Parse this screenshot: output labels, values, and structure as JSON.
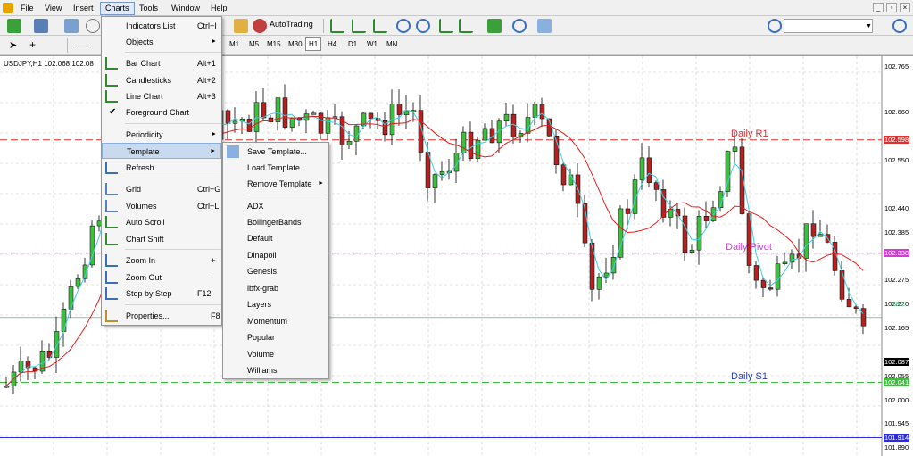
{
  "menubar": {
    "items": [
      "File",
      "View",
      "Insert",
      "Charts",
      "Tools",
      "Window",
      "Help"
    ],
    "window_controls": [
      "_",
      "▫",
      "×"
    ]
  },
  "toolbar": {
    "autotrading_label": "AutoTrading",
    "timeframes": [
      "M1",
      "M5",
      "M15",
      "M30",
      "H1",
      "H4",
      "D1",
      "W1",
      "MN"
    ],
    "active_timeframe": "H1",
    "search_value": ""
  },
  "chart": {
    "title": "USDJPY,H1  102.068 102.08",
    "price_axis": [
      "102.765",
      "102.660",
      "102.598",
      "102.550",
      "102.440",
      "102.385",
      "102.338",
      "102.275",
      "102.220",
      "102.165",
      "102.087",
      "102.055",
      "102.041",
      "102.000",
      "101.945",
      "101.914",
      "101.890"
    ],
    "highlighted_prices": {
      "r1": "102.598",
      "pivot": "102.338",
      "bid": "102.087",
      "s1": "102.041",
      "low": "101.914"
    },
    "levels": {
      "r1_label": "Daily R1",
      "pivot_label": "Daily Pivot",
      "s1_label": "Daily S1"
    },
    "fib_label": "38.2",
    "colors": {
      "r1": "#e03030",
      "pivot": "#d040d0",
      "s1": "#3cbf3c",
      "low": "#2a2ae0",
      "fib": "#3aa36a",
      "bull": "#3cbf3c",
      "bear": "#b22222",
      "ma_red": "#e02020",
      "ma_cyan": "#40d0e0"
    }
  },
  "charts_menu": {
    "items": [
      {
        "label": "Indicators List",
        "shortcut": "Ctrl+I"
      },
      {
        "label": "Objects",
        "arrow": "►"
      },
      {
        "label": "Bar Chart",
        "shortcut": "Alt+1"
      },
      {
        "label": "Candlesticks",
        "shortcut": "Alt+2"
      },
      {
        "label": "Line Chart",
        "shortcut": "Alt+3"
      },
      {
        "label": "Foreground Chart",
        "check": "✔"
      },
      {
        "label": "Periodicity",
        "arrow": "►"
      },
      {
        "label": "Template",
        "arrow": "►"
      },
      {
        "label": "Refresh"
      },
      {
        "label": "Grid",
        "shortcut": "Ctrl+G"
      },
      {
        "label": "Volumes",
        "shortcut": "Ctrl+L"
      },
      {
        "label": "Auto Scroll"
      },
      {
        "label": "Chart Shift"
      },
      {
        "label": "Zoom In",
        "shortcut": "+"
      },
      {
        "label": "Zoom Out",
        "shortcut": "-"
      },
      {
        "label": "Step by Step",
        "shortcut": "F12"
      },
      {
        "label": "Properties...",
        "shortcut": "F8"
      }
    ]
  },
  "template_menu": {
    "items": [
      {
        "label": "Save Template..."
      },
      {
        "label": "Load Template..."
      },
      {
        "label": "Remove Template",
        "arrow": "►"
      },
      {
        "label": "ADX"
      },
      {
        "label": "BollingerBands"
      },
      {
        "label": "Default"
      },
      {
        "label": "Dinapoli"
      },
      {
        "label": "Genesis"
      },
      {
        "label": "lbfx-grab"
      },
      {
        "label": "Layers"
      },
      {
        "label": "Momentum"
      },
      {
        "label": "Popular"
      },
      {
        "label": "Volume"
      },
      {
        "label": "Williams"
      }
    ]
  }
}
